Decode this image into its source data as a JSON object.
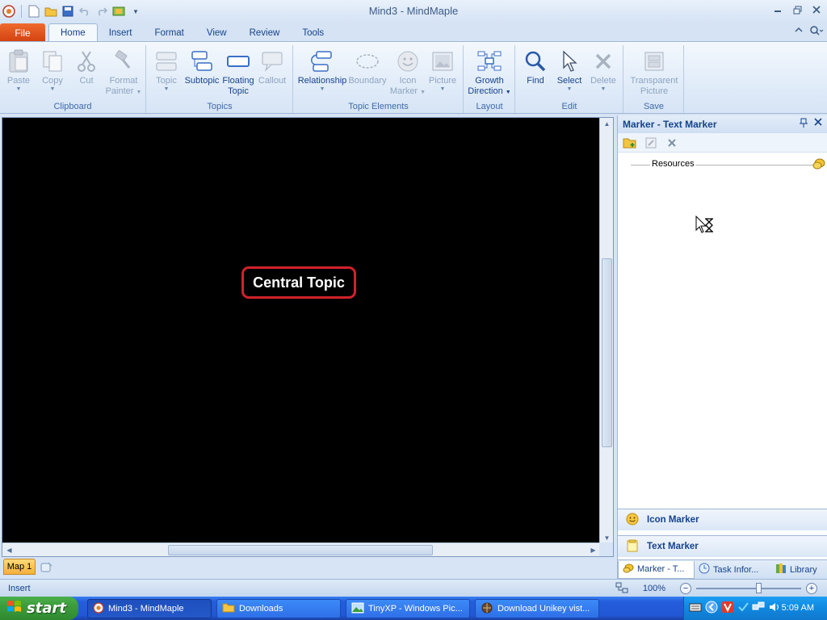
{
  "window": {
    "title": "Mind3 - MindMaple",
    "controls": [
      "minimize",
      "restore",
      "close"
    ]
  },
  "ribbon_tabs": {
    "file": "File",
    "items": [
      "Home",
      "Insert",
      "Format",
      "View",
      "Review",
      "Tools"
    ],
    "active": "Home"
  },
  "ribbon": {
    "clipboard": {
      "label": "Clipboard",
      "paste": "Paste",
      "copy": "Copy",
      "cut": "Cut",
      "format_painter_1": "Format",
      "format_painter_2": "Painter"
    },
    "topics": {
      "label": "Topics",
      "topic": "Topic",
      "subtopic": "Subtopic",
      "floating_1": "Floating",
      "floating_2": "Topic",
      "callout": "Callout"
    },
    "topic_elements": {
      "label": "Topic Elements",
      "relationship": "Relationship",
      "boundary": "Boundary",
      "icon_marker_1": "Icon",
      "icon_marker_2": "Marker",
      "picture": "Picture"
    },
    "layout": {
      "label": "Layout",
      "growth_1": "Growth",
      "growth_2": "Direction"
    },
    "edit": {
      "label": "Edit",
      "find": "Find",
      "select": "Select",
      "delete": "Delete"
    },
    "save": {
      "label": "Save",
      "transparent_1": "Transparent",
      "transparent_2": "Picture"
    }
  },
  "canvas": {
    "central_topic": "Central Topic",
    "background": "#000000",
    "topic_border": "#d0222b"
  },
  "sheet_tabs": {
    "active": "Map 1"
  },
  "panel": {
    "title": "Marker - Text Marker",
    "tree_item": "Resources",
    "icon_marker": "Icon Marker",
    "text_marker": "Text Marker",
    "tabs": [
      "Marker - T...",
      "Task Infor...",
      "Library"
    ]
  },
  "status": {
    "mode": "Insert",
    "zoom": "100%",
    "zoom_fraction": 0.6
  },
  "taskbar": {
    "start": "start",
    "tasks": [
      "Mind3 - MindMaple",
      "Downloads",
      "TinyXP - Windows Pic...",
      "Download Unikey vist..."
    ],
    "clock": "5:09 AM"
  }
}
